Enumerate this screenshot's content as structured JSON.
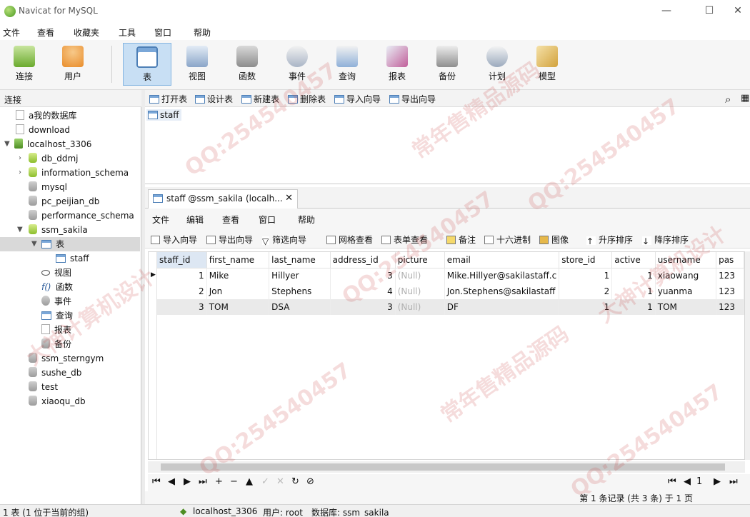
{
  "window": {
    "title": "Navicat for MySQL",
    "controls": [
      "—",
      "☐",
      "✕"
    ]
  },
  "menu": [
    "文件",
    "查看",
    "收藏夹",
    "工具",
    "窗口",
    "帮助"
  ],
  "toolbar": [
    {
      "label": "连接",
      "icon": "connection-icon",
      "color": "#7fc241"
    },
    {
      "label": "用户",
      "icon": "user-icon",
      "color": "#f2a54a"
    },
    {
      "label": "表",
      "icon": "table-icon",
      "color": "#5b8fc9",
      "active": true
    },
    {
      "label": "视图",
      "icon": "view-icon",
      "color": "#8aa5c8"
    },
    {
      "label": "函数",
      "icon": "function-icon",
      "color": "#e5a23a"
    },
    {
      "label": "事件",
      "icon": "event-icon",
      "color": "#7b93b3"
    },
    {
      "label": "查询",
      "icon": "query-icon",
      "color": "#6b96c9"
    },
    {
      "label": "报表",
      "icon": "report-icon",
      "color": "#c15f9a"
    },
    {
      "label": "备份",
      "icon": "backup-icon",
      "color": "#8e8e8e"
    },
    {
      "label": "计划",
      "icon": "schedule-icon",
      "color": "#7c8ea8"
    },
    {
      "label": "模型",
      "icon": "model-icon",
      "color": "#d2a23d"
    }
  ],
  "left": {
    "header": "连接",
    "tree": [
      {
        "label": "a我的数据库",
        "icon": "doc"
      },
      {
        "label": "download",
        "icon": "doc"
      },
      {
        "label": "localhost_3306",
        "icon": "conn",
        "expanded": true
      },
      {
        "label": "db_ddmj",
        "icon": "db-g",
        "collapsed": true
      },
      {
        "label": "information_schema",
        "icon": "db-g",
        "collapsed": true
      },
      {
        "label": "mysql",
        "icon": "db"
      },
      {
        "label": "pc_peijian_db",
        "icon": "db"
      },
      {
        "label": "performance_schema",
        "icon": "db"
      },
      {
        "label": "ssm_sakila",
        "icon": "db-g",
        "expanded": true
      },
      {
        "label": "表",
        "icon": "tbl",
        "expanded": true,
        "selected": true
      },
      {
        "label": "staff",
        "icon": "tbl"
      },
      {
        "label": "视图",
        "icon": "view"
      },
      {
        "label": "函数",
        "icon": "func"
      },
      {
        "label": "事件",
        "icon": "event"
      },
      {
        "label": "查询",
        "icon": "query"
      },
      {
        "label": "报表",
        "icon": "report"
      },
      {
        "label": "备份",
        "icon": "backup"
      },
      {
        "label": "ssm_sterngym",
        "icon": "db"
      },
      {
        "label": "sushe_db",
        "icon": "db"
      },
      {
        "label": "test",
        "icon": "db"
      },
      {
        "label": "xiaoqu_db",
        "icon": "db"
      }
    ]
  },
  "objbar": [
    "打开表",
    "设计表",
    "新建表",
    "删除表",
    "导入向导",
    "导出向导"
  ],
  "objects": [
    "staff"
  ],
  "tab": {
    "label": "staff @ssm_sakila (localh...",
    "close": "✕"
  },
  "inner_menu": [
    "文件",
    "编辑",
    "查看",
    "窗口",
    "帮助"
  ],
  "grid_toolbar": [
    "导入向导",
    "导出向导",
    "筛选向导",
    "网格查看",
    "表单查看",
    "备注",
    "十六进制",
    "图像",
    "升序排序",
    "降序排序"
  ],
  "grid": {
    "columns": [
      "staff_id",
      "first_name",
      "last_name",
      "address_id",
      "picture",
      "email",
      "store_id",
      "active",
      "username",
      "pas"
    ],
    "rows": [
      [
        "1",
        "Mike",
        "Hillyer",
        "3",
        "(Null)",
        "Mike.Hillyer@sakilastaff.c",
        "1",
        "1",
        "xiaowang",
        "123"
      ],
      [
        "2",
        "Jon",
        "Stephens",
        "4",
        "(Null)",
        "Jon.Stephens@sakilastaff",
        "2",
        "1",
        "yuanma",
        "123"
      ],
      [
        "3",
        "TOM",
        "DSA",
        "3",
        "(Null)",
        "DF",
        "1",
        "1",
        "TOM",
        "123"
      ]
    ]
  },
  "nav": {
    "buttons": [
      "⏮",
      "◀",
      "▶",
      "⏭",
      "+",
      "−",
      "▲",
      "✓",
      "✕",
      "↻",
      "⊘"
    ],
    "page": "1",
    "status": "第 1 条记录 (共 3 条) 于 1 页"
  },
  "statusbar": {
    "left": "1 表 (1 位于当前的组)",
    "connection": "localhost_3306",
    "user": "用户: root",
    "database": "数据库: ssm_sakila"
  },
  "watermark": {
    "lines": [
      "QQ:254540457",
      "常年售精品源码",
      "大神计算机设计"
    ]
  }
}
